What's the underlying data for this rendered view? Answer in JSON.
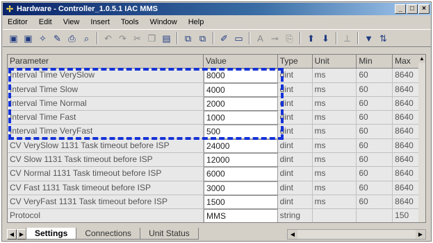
{
  "window": {
    "title": "Hardware - Controller_1.0.5.1 IAC MMS",
    "buttons": [
      "_",
      "□",
      "×"
    ]
  },
  "menu": [
    "Editor",
    "Edit",
    "View",
    "Insert",
    "Tools",
    "Window",
    "Help"
  ],
  "toolbar": [
    {
      "name": "save-icon",
      "glyph": "▣"
    },
    {
      "name": "save-all-icon",
      "glyph": "▣"
    },
    {
      "name": "wizard-icon",
      "glyph": "✧"
    },
    {
      "name": "tool-icon",
      "glyph": "✎"
    },
    {
      "name": "print-icon",
      "glyph": "⎙"
    },
    {
      "name": "preview-icon",
      "glyph": "⌕"
    },
    {
      "sep": true
    },
    {
      "name": "undo-icon",
      "glyph": "↶",
      "dim": true
    },
    {
      "name": "redo-icon",
      "glyph": "↷",
      "dim": true
    },
    {
      "name": "cut-icon",
      "glyph": "✂",
      "dim": true
    },
    {
      "name": "copy-icon",
      "glyph": "❐",
      "dim": true
    },
    {
      "name": "paste-icon",
      "glyph": "▤"
    },
    {
      "sep": true
    },
    {
      "name": "network-icon",
      "glyph": "⧉"
    },
    {
      "name": "network2-icon",
      "glyph": "⧉"
    },
    {
      "sep": true
    },
    {
      "name": "pencil-icon",
      "glyph": "✐"
    },
    {
      "name": "monitor-icon",
      "glyph": "▭"
    },
    {
      "sep": true
    },
    {
      "name": "font-icon",
      "glyph": "A",
      "dim": true
    },
    {
      "name": "link-icon",
      "glyph": "⊸",
      "dim": true
    },
    {
      "name": "doc-icon",
      "glyph": "⎘",
      "dim": true
    },
    {
      "sep": true
    },
    {
      "name": "arrow-up-icon",
      "glyph": "⬆"
    },
    {
      "name": "arrow-down-icon",
      "glyph": "⬇"
    },
    {
      "sep": true
    },
    {
      "name": "anchor-icon",
      "glyph": "⊥",
      "dim": true
    },
    {
      "sep": true
    },
    {
      "name": "filter-icon",
      "glyph": "▼"
    },
    {
      "name": "sort-icon",
      "glyph": "⇅"
    }
  ],
  "grid": {
    "columns": [
      "Parameter",
      "Value",
      "Type",
      "Unit",
      "Min",
      "Max"
    ],
    "rows": [
      {
        "parameter": "Interval Time VerySlow",
        "value": "8000",
        "type": "dint",
        "unit": "ms",
        "min": "60",
        "max": "8640"
      },
      {
        "parameter": "Interval Time Slow",
        "value": "4000",
        "type": "dint",
        "unit": "ms",
        "min": "60",
        "max": "8640"
      },
      {
        "parameter": "Interval Time Normal",
        "value": "2000",
        "type": "dint",
        "unit": "ms",
        "min": "60",
        "max": "8640"
      },
      {
        "parameter": "Interval Time Fast",
        "value": "1000",
        "type": "dint",
        "unit": "ms",
        "min": "60",
        "max": "8640"
      },
      {
        "parameter": "Interval Time VeryFast",
        "value": "500",
        "type": "dint",
        "unit": "ms",
        "min": "60",
        "max": "8640"
      },
      {
        "parameter": "CV VerySlow 1131 Task timeout before ISP",
        "value": "24000",
        "type": "dint",
        "unit": "ms",
        "min": "60",
        "max": "8640"
      },
      {
        "parameter": "CV Slow 1131 Task timeout before ISP",
        "value": "12000",
        "type": "dint",
        "unit": "ms",
        "min": "60",
        "max": "8640"
      },
      {
        "parameter": "CV Normal 1131 Task timeout before ISP",
        "value": "6000",
        "type": "dint",
        "unit": "ms",
        "min": "60",
        "max": "8640"
      },
      {
        "parameter": "CV Fast 1131 Task timeout before ISP",
        "value": "3000",
        "type": "dint",
        "unit": "ms",
        "min": "60",
        "max": "8640"
      },
      {
        "parameter": "CV VeryFast 1131 Task timeout before ISP",
        "value": "1500",
        "type": "dint",
        "unit": "ms",
        "min": "60",
        "max": "8640"
      },
      {
        "parameter": "Protocol",
        "value": "MMS",
        "type": "string",
        "unit": "",
        "min": "",
        "max": "150"
      }
    ]
  },
  "tabs": [
    {
      "label": "Settings",
      "active": true
    },
    {
      "label": "Connections",
      "active": false
    },
    {
      "label": "Unit Status",
      "active": false
    }
  ],
  "colors": {
    "highlight": "#1432d8",
    "title_start": "#0a246a"
  }
}
